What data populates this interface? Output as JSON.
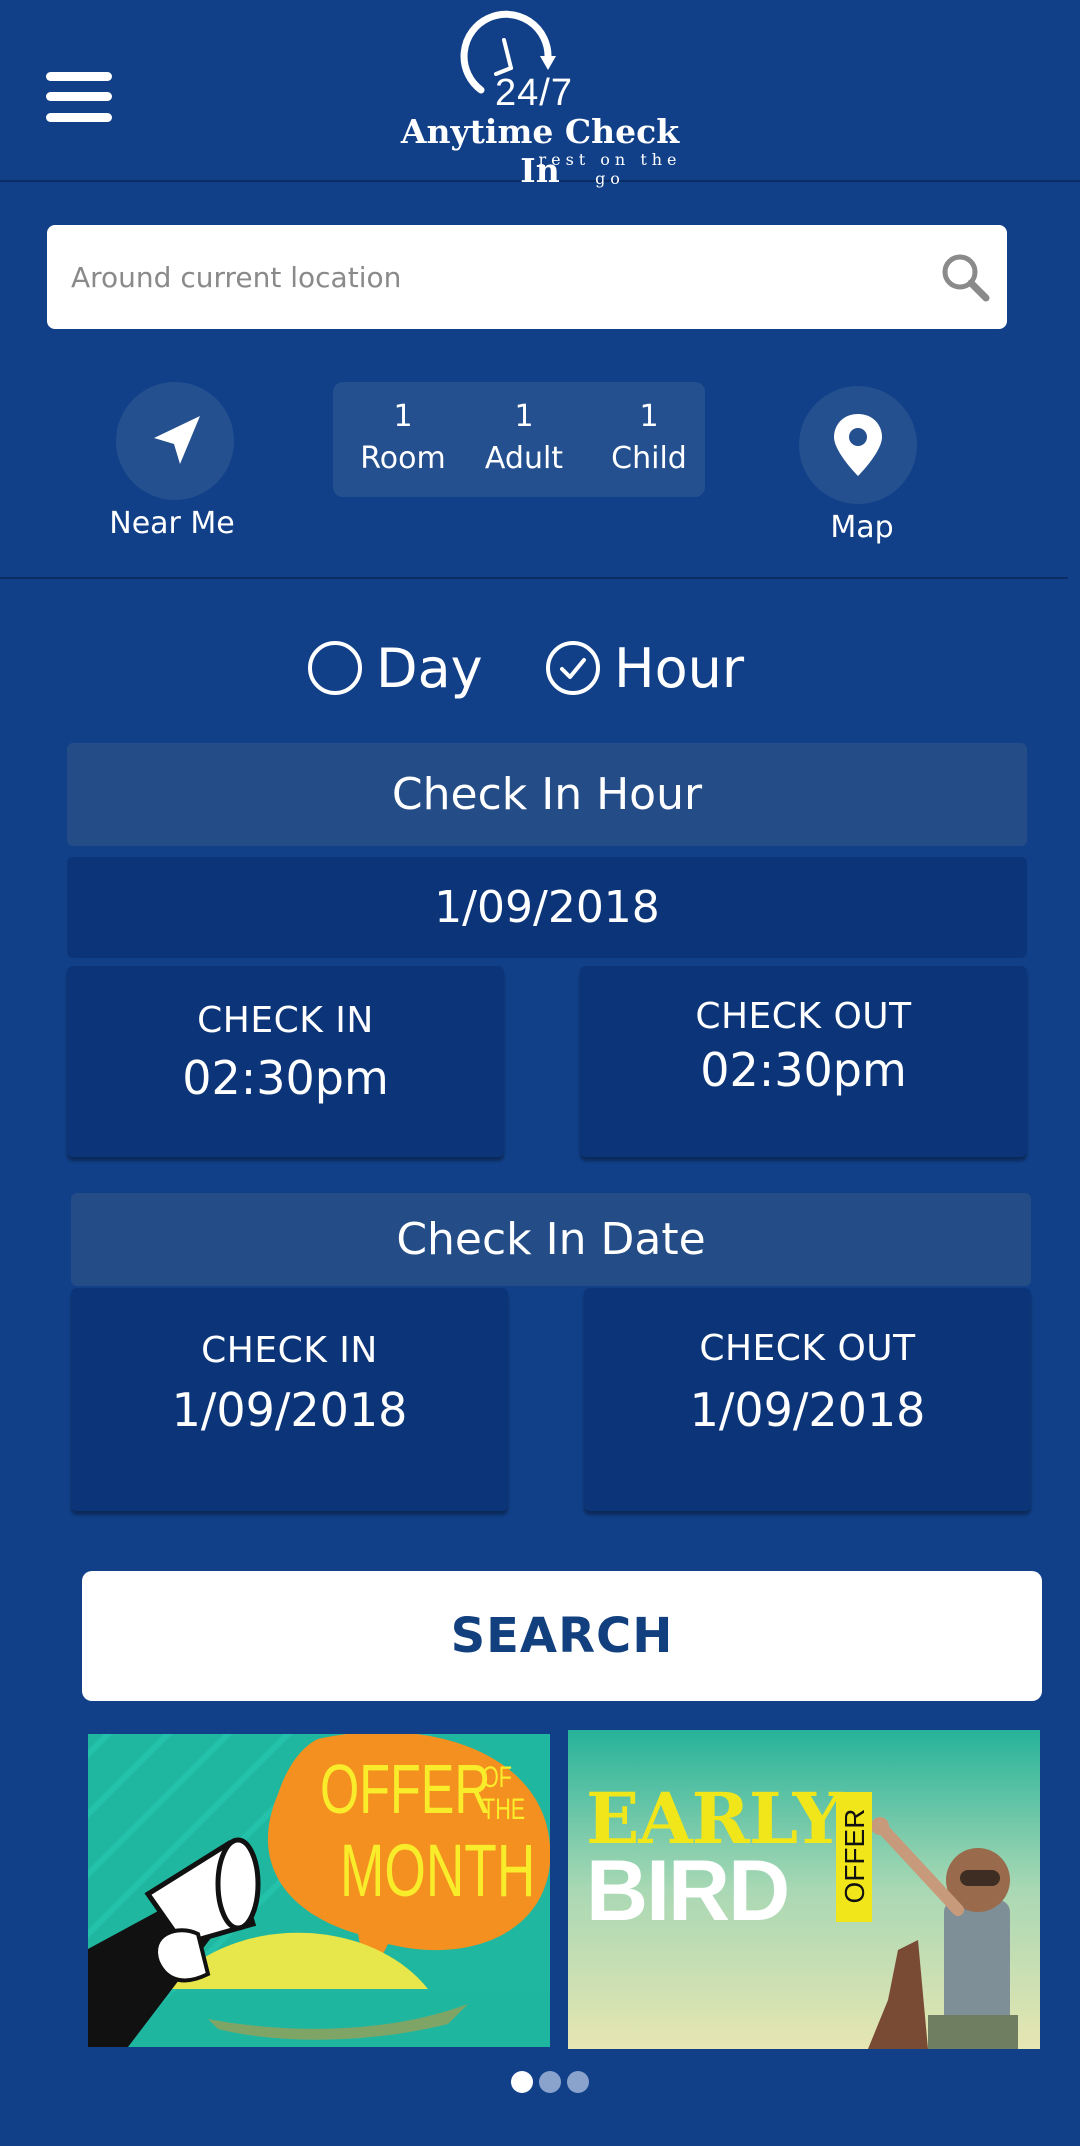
{
  "header": {
    "logo_number": "24/7",
    "logo_name": "Anytime Check In",
    "logo_tagline": "rest on the go"
  },
  "search": {
    "placeholder": "Around current location"
  },
  "quick_actions": {
    "near_me_label": "Near Me",
    "map_label": "Map"
  },
  "guests": [
    {
      "count": "1",
      "label": "Room"
    },
    {
      "count": "1",
      "label": "Adult"
    },
    {
      "count": "1",
      "label": "Child"
    }
  ],
  "booking_mode": {
    "options": [
      {
        "label": "Day",
        "selected": false
      },
      {
        "label": "Hour",
        "selected": true
      }
    ]
  },
  "hour_section": {
    "title": "Check In Hour",
    "date": "1/09/2018",
    "check_in_label": "CHECK IN",
    "check_in_time": "02:30pm",
    "check_out_label": "CHECK OUT",
    "check_out_time": "02:30pm"
  },
  "date_section": {
    "title": "Check In Date",
    "check_in_label": "CHECK IN",
    "check_in_date": "1/09/2018",
    "check_out_label": "CHECK OUT",
    "check_out_date": "1/09/2018"
  },
  "search_button_label": "SEARCH",
  "banners": [
    {
      "line1": "OFFER",
      "small": "OF THE",
      "line2": "MONTH"
    },
    {
      "line1": "EARLY",
      "line2": "BIRD",
      "side": "OFFER"
    }
  ],
  "carousel": {
    "count": 3,
    "active_index": 0
  },
  "colors": {
    "background": "#114089",
    "panel": "#244c87",
    "box": "#0c3579",
    "button_text": "#12407f",
    "offer_orange": "#f3901f",
    "offer_teal": "#1fb7a0",
    "bird_yellow": "#f1e619"
  },
  "icons": [
    "menu-icon",
    "clock-icon",
    "search-icon",
    "navigation-arrow-icon",
    "map-pin-icon",
    "radio-empty-icon",
    "radio-checked-icon",
    "megaphone-icon"
  ]
}
